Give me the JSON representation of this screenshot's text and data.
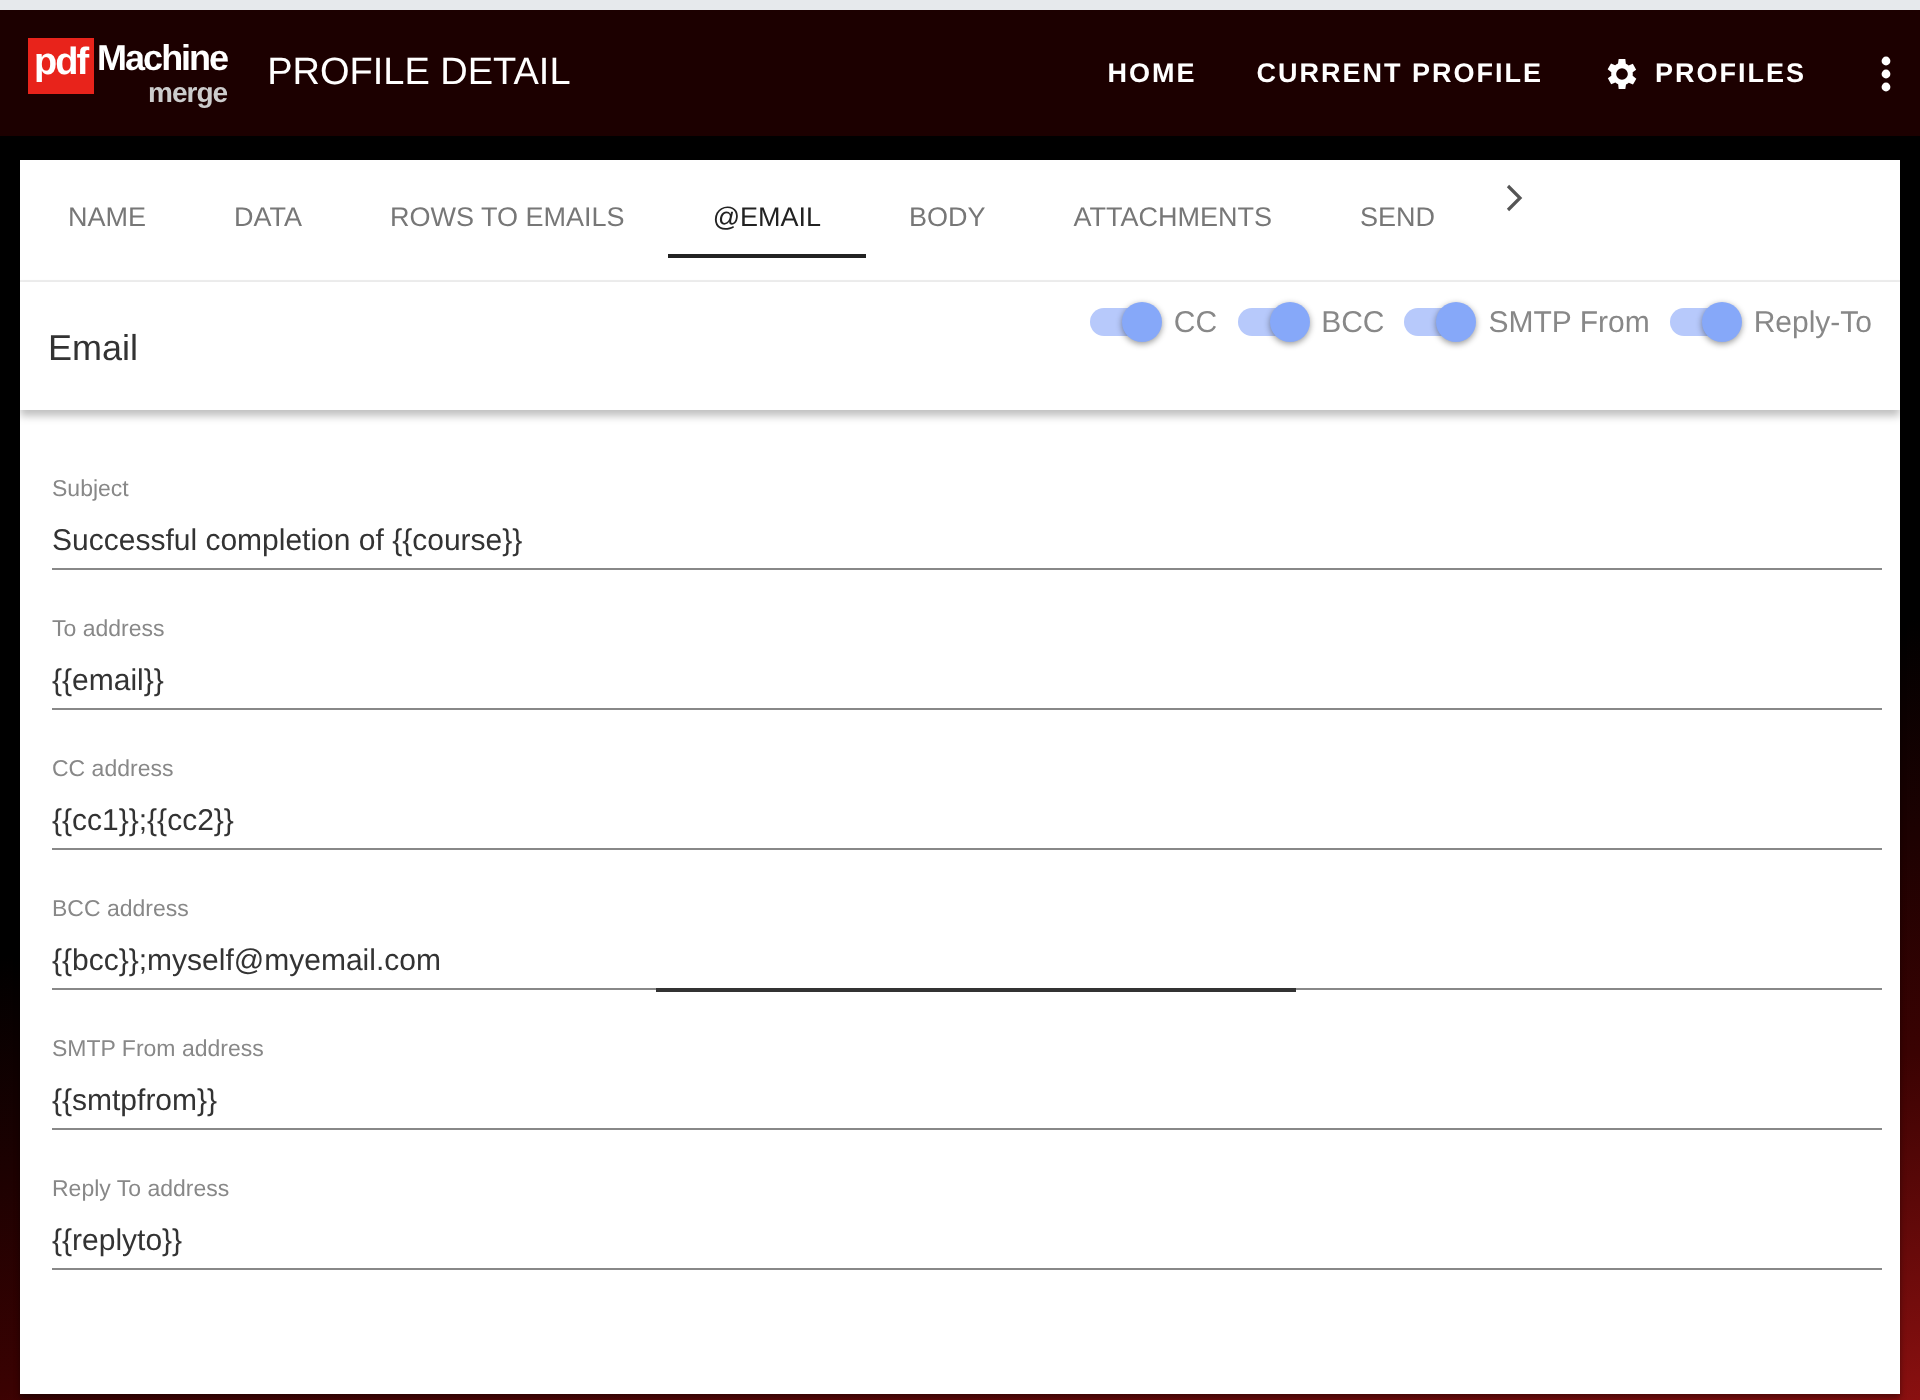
{
  "logo": {
    "badge": "pdf",
    "name": "Machine",
    "sub": "merge"
  },
  "header": {
    "title": "PROFILE DETAIL",
    "nav": [
      {
        "label": "HOME",
        "kind": "text"
      },
      {
        "label": "CURRENT PROFILE",
        "kind": "text"
      },
      {
        "label": "PROFILES",
        "kind": "gear"
      }
    ]
  },
  "tabs": [
    {
      "label": "NAME",
      "selected": false
    },
    {
      "label": "DATA",
      "selected": false
    },
    {
      "label": "ROWS TO EMAILS",
      "selected": false
    },
    {
      "label": "@EMAIL",
      "selected": true
    },
    {
      "label": "BODY",
      "selected": false
    },
    {
      "label": "ATTACHMENTS",
      "selected": false
    },
    {
      "label": "SEND",
      "selected": false
    }
  ],
  "panel": {
    "title": "Email",
    "toggles": [
      {
        "label": "CC",
        "on": true
      },
      {
        "label": "BCC",
        "on": true
      },
      {
        "label": "SMTP From",
        "on": true
      },
      {
        "label": "Reply-To",
        "on": true
      }
    ]
  },
  "fields": [
    {
      "label": "Subject",
      "value": "Successful completion of {{course}}",
      "focused": false
    },
    {
      "label": "To address",
      "value": "{{email}}",
      "focused": false
    },
    {
      "label": "CC address",
      "value": "{{cc1}};{{cc2}}",
      "focused": false
    },
    {
      "label": "BCC address",
      "value": "{{bcc}};myself@myemail.com",
      "focused": true
    },
    {
      "label": "SMTP From address",
      "value": "{{smtpfrom}}",
      "focused": false
    },
    {
      "label": "Reply To address",
      "value": "{{replyto}}",
      "focused": false
    }
  ]
}
